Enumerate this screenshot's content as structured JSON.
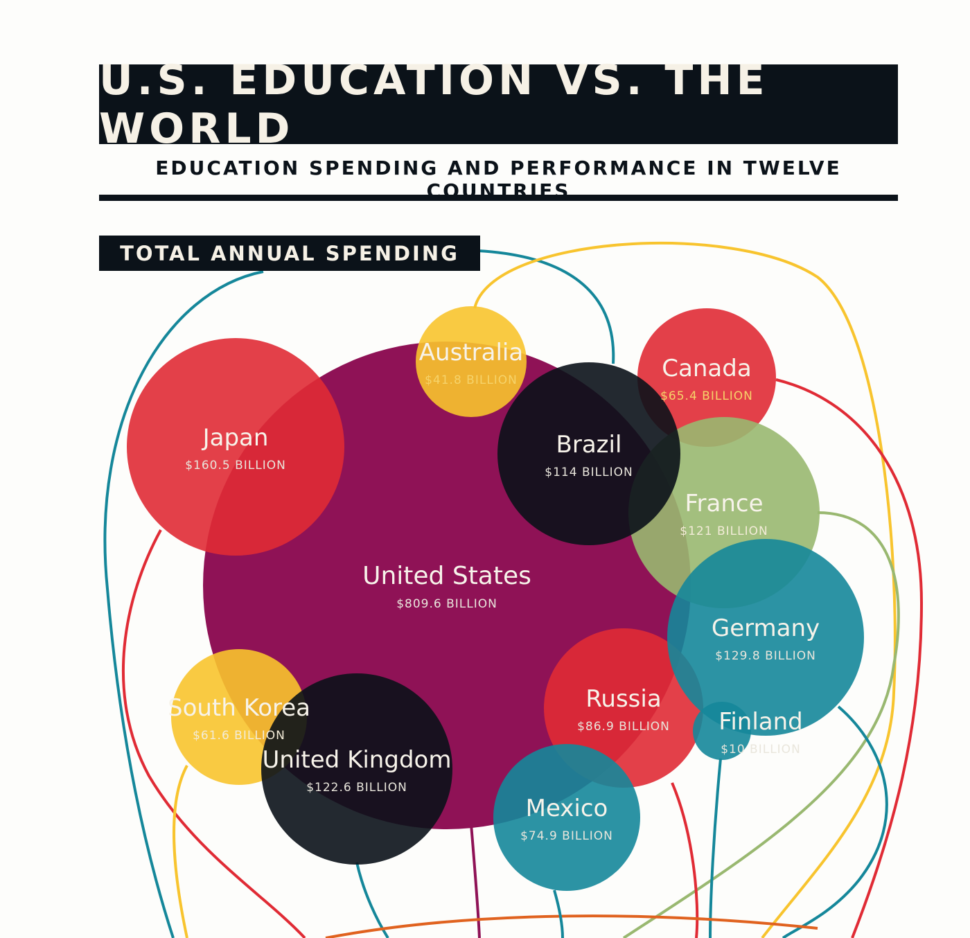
{
  "header": {
    "title": "U.S. EDUCATION VS. THE WORLD",
    "subtitle": "EDUCATION SPENDING AND PERFORMANCE IN TWELVE COUNTRIES",
    "section": "TOTAL ANNUAL SPENDING"
  },
  "chart_data": {
    "type": "bubble",
    "title": "TOTAL ANNUAL SPENDING",
    "unit": "BILLION",
    "series": [
      {
        "name": "United States",
        "value": 809.6,
        "label": "$809.6 BILLION",
        "color": "#8f1256"
      },
      {
        "name": "Japan",
        "value": 160.5,
        "label": "$160.5 BILLION",
        "color": "#e02b35"
      },
      {
        "name": "Australia",
        "value": 41.8,
        "label": "$41.8 BILLION",
        "color": "#f8c42e"
      },
      {
        "name": "Canada",
        "value": 65.4,
        "label": "$65.4 BILLION",
        "color": "#e02b35"
      },
      {
        "name": "Brazil",
        "value": 114,
        "label": "$114 BILLION",
        "color": "#0b1219"
      },
      {
        "name": "France",
        "value": 121,
        "label": "$121 BILLION",
        "color": "#99b870"
      },
      {
        "name": "Germany",
        "value": 129.8,
        "label": "$129.8 BILLION",
        "color": "#15879a"
      },
      {
        "name": "South Korea",
        "value": 61.6,
        "label": "$61.6 BILLION",
        "color": "#f8c42e"
      },
      {
        "name": "United Kingdom",
        "value": 122.6,
        "label": "$122.6 BILLION",
        "color": "#0b1219"
      },
      {
        "name": "Russia",
        "value": 86.9,
        "label": "$86.9 BILLION",
        "color": "#e02b35"
      },
      {
        "name": "Mexico",
        "value": 74.9,
        "label": "$74.9 BILLION",
        "color": "#15879a"
      },
      {
        "name": "Finland",
        "value": 10,
        "label": "$10 BILLION",
        "color": "#15879a"
      }
    ]
  }
}
